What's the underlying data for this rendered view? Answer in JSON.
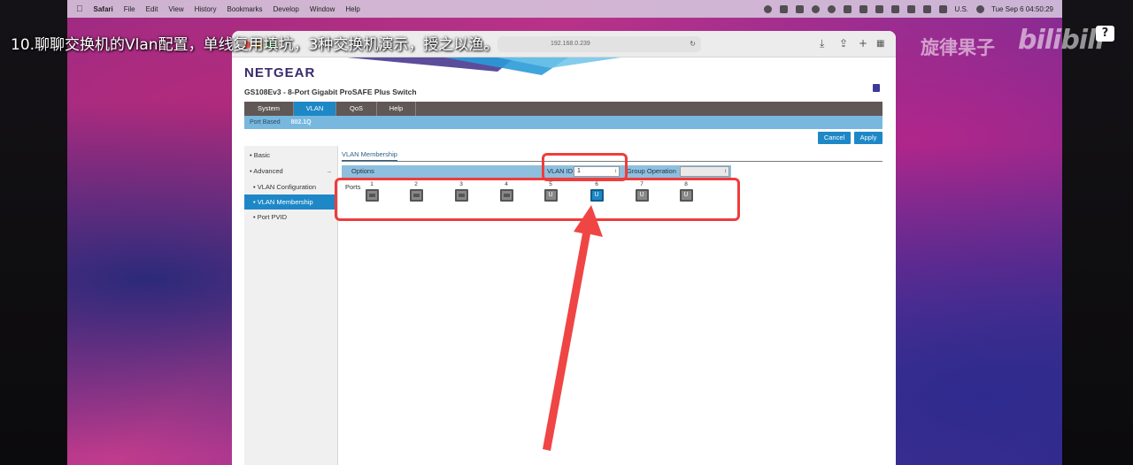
{
  "menubar": {
    "apple_icon": "apple-icon",
    "app_name": "Safari",
    "items": [
      "File",
      "Edit",
      "View",
      "History",
      "Bookmarks",
      "Develop",
      "Window",
      "Help"
    ],
    "input_source": "U.S.",
    "datetime": "Tue Sep 6  04:50:29"
  },
  "safari": {
    "url_text": "192.168.0.239",
    "toolbar_icons": [
      "download-icon",
      "share-icon",
      "new-tab-icon",
      "tab-overview-icon"
    ]
  },
  "netgear": {
    "logo": "NETGEAR",
    "model": "GS108Ev3 - 8-Port Gigabit ProSAFE Plus Switch",
    "nav": [
      "System",
      "VLAN",
      "QoS",
      "Help"
    ],
    "subnav": [
      "Port Based",
      "802.1Q"
    ],
    "buttons": {
      "cancel": "Cancel",
      "apply": "Apply"
    },
    "sidebar": {
      "basic": "Basic",
      "advanced": "Advanced",
      "vlan_config": "VLAN Configuration",
      "vlan_membership": "VLAN Membership",
      "port_pvid": "Port PVID"
    },
    "content_title": "VLAN Membership",
    "options_label": "Options",
    "vlan_id_label": "VLAN ID",
    "vlan_id_value": "1",
    "group_operation_label": "Group Operation",
    "group_operation_value": "",
    "ports_label": "Ports",
    "ports": [
      {
        "num": "1",
        "state": ""
      },
      {
        "num": "2",
        "state": ""
      },
      {
        "num": "3",
        "state": ""
      },
      {
        "num": "4",
        "state": ""
      },
      {
        "num": "5",
        "state": "U"
      },
      {
        "num": "6",
        "state": "U"
      },
      {
        "num": "7",
        "state": "U"
      },
      {
        "num": "8",
        "state": "U"
      }
    ]
  },
  "overlay": {
    "subtitle": "10.聊聊交换机的Vlan配置，单线复用填坑，3种交换机演示，授之以渔。",
    "watermark": "旋律果子",
    "watermark_logo": "bilibili",
    "help_badge": "?"
  }
}
